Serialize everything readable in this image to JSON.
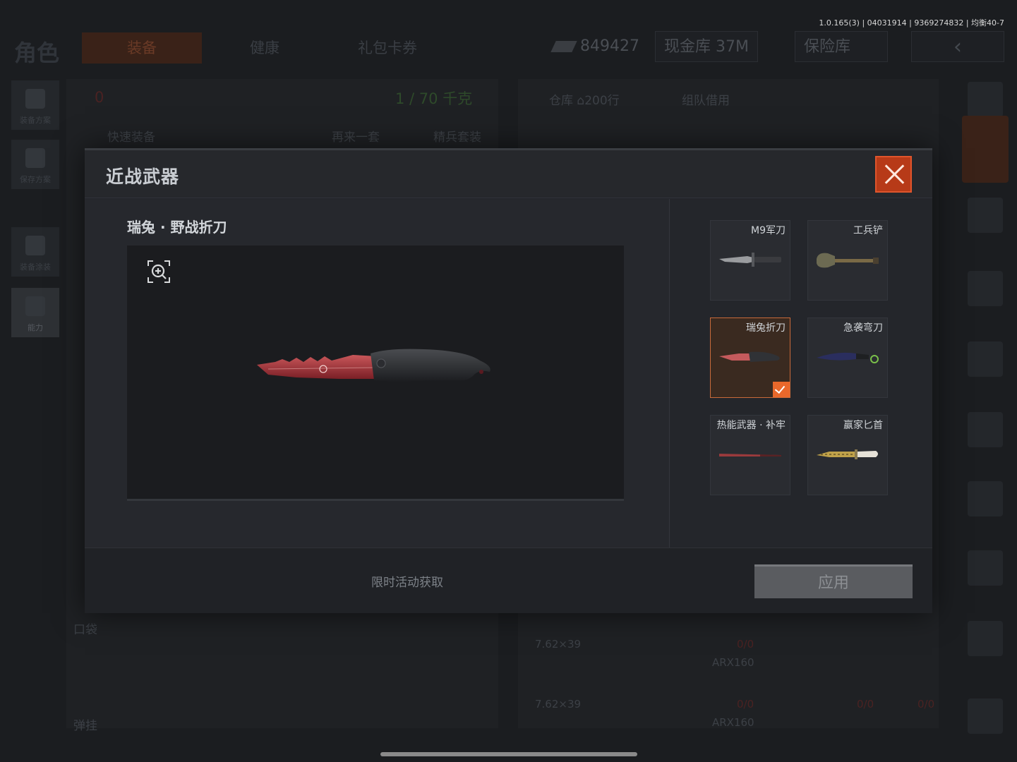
{
  "status_bar": {
    "version": "1.0.165(3) | 04031914 | 9369274832 | 均衡40-7"
  },
  "top_nav": {
    "logo": "角色",
    "tabs": [
      {
        "label": "装备"
      },
      {
        "label": "健康"
      },
      {
        "label": "礼包卡券"
      }
    ],
    "currency": "849427",
    "cash_vault": "现金库 37M",
    "safe": "保险库"
  },
  "left_rail": [
    {
      "label": "装备方案"
    },
    {
      "label": "保存方案"
    },
    {
      "label": "装备涂装"
    },
    {
      "label": "能力"
    }
  ],
  "background": {
    "armor_count": "0",
    "weight": "1 / 70 千克",
    "quick_equip": "快速装备",
    "again": "再来一套",
    "elite": "精兵套装",
    "warehouse": "仓库",
    "warehouse_rows": "200行",
    "team_borrow": "组队借用",
    "pocket": "口袋",
    "ammo": "弹挂",
    "ammo_type_1": "7.62×39",
    "ammo_type_2": "7.62×39",
    "gun_1": "ARX160",
    "gun_2": "ARX160",
    "count_1": "0/0",
    "count_2": "0/0",
    "count_3": "0/0",
    "count_4": "0/0"
  },
  "modal": {
    "title": "近战武器",
    "selected_name": "瑞兔 · 野战折刀",
    "weapons": [
      {
        "label": "M9军刀",
        "icon": "m9-bayonet-icon",
        "selected": false
      },
      {
        "label": "工兵铲",
        "icon": "shovel-icon",
        "selected": false
      },
      {
        "label": "瑞兔折刀",
        "icon": "folding-knife-icon",
        "selected": true
      },
      {
        "label": "急袭弯刀",
        "icon": "karambit-icon",
        "selected": false
      },
      {
        "label": "热能武器 · 补牢",
        "icon": "thermal-blade-icon",
        "selected": false
      },
      {
        "label": "赢家匕首",
        "icon": "dagger-icon",
        "selected": false
      }
    ],
    "footer_hint": "限时活动获取",
    "apply_label": "应用"
  },
  "colors": {
    "accent": "#e9682b",
    "close_bg": "#b73a18",
    "apply_bg": "#5a5c60"
  }
}
